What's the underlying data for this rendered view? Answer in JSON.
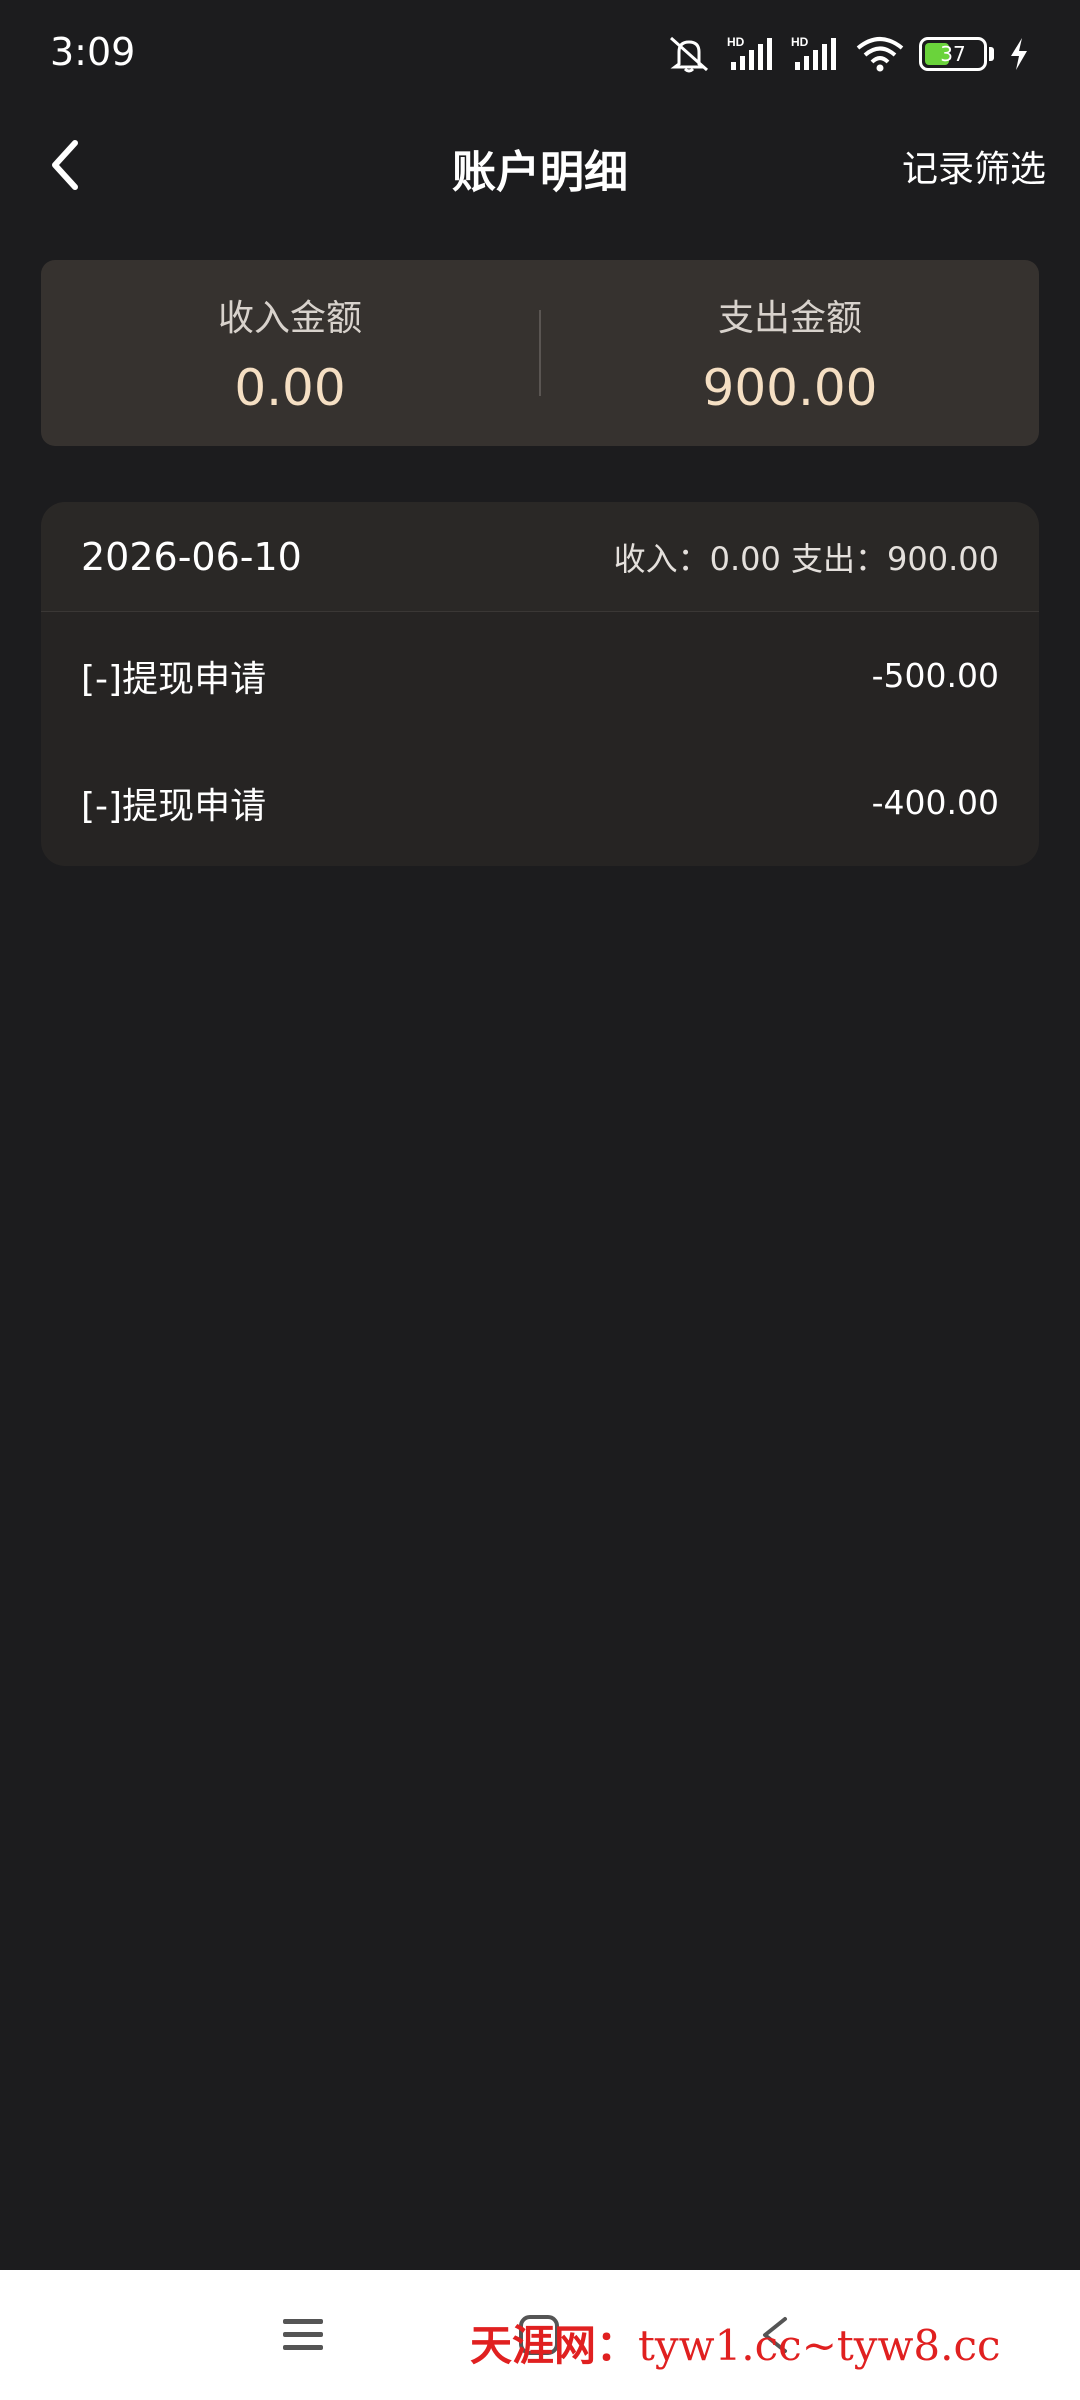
{
  "status_bar": {
    "time": "3:09",
    "battery_level": "37",
    "icons": [
      "mute-icon",
      "hd-signal-icon",
      "hd-signal-icon",
      "wifi-icon",
      "battery-icon",
      "charging-icon"
    ]
  },
  "header": {
    "title": "账户明细",
    "filter_label": "记录筛选"
  },
  "summary": {
    "income_label": "收入金额",
    "income_value": "0.00",
    "expense_label": "支出金额",
    "expense_value": "900.00"
  },
  "records": {
    "date": "2026-06-10",
    "totals": "收入：0.00 支出：900.00",
    "items": [
      {
        "title": "[-]提现申请",
        "amount": "-500.00"
      },
      {
        "title": "[-]提现申请",
        "amount": "-400.00"
      }
    ]
  },
  "watermark": {
    "cn": "天涯网：",
    "url": "tyw1.cc~tyw8.cc"
  },
  "colors": {
    "background": "#1c1c1e",
    "summary_card": "#36322f",
    "accent_gold": "#f5dfc3",
    "battery_green": "#6ad33b",
    "watermark_red": "#e02020"
  }
}
